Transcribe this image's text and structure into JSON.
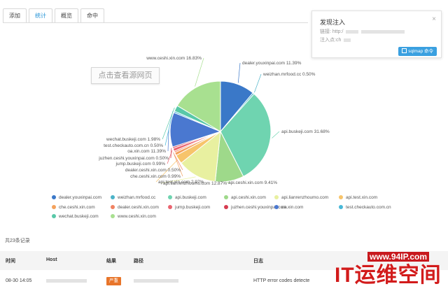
{
  "tabs": [
    {
      "label": "添加",
      "active": false
    },
    {
      "label": "统计",
      "active": true
    },
    {
      "label": "概览",
      "active": false
    },
    {
      "label": "命中",
      "active": false
    }
  ],
  "notify": {
    "title": "发现注入",
    "close": "×",
    "line1_prefix": "链接: http:/",
    "line2_prefix": "注入点:ch",
    "button": "sqlmap 命令"
  },
  "source_tip": "点击查看源网页",
  "chart_data": {
    "type": "pie",
    "slices": [
      {
        "name": "dealer.youxinpai.com",
        "label": "dealer.youxinpai.com 11.39%",
        "value": 11.39,
        "color": "#3a78c8"
      },
      {
        "name": "weizhan.mrfood.cc",
        "label": "weizhan.mrfood.cc 0.50%",
        "value": 0.5,
        "color": "#4bb3c8"
      },
      {
        "name": "api.buskeji.com",
        "label": "api.buskeji.com 31.68%",
        "value": 31.68,
        "color": "#6fd4b0"
      },
      {
        "name": "api.ceshi.xin.com",
        "label": "api.ceshi.xin.com 9.41%",
        "value": 9.41,
        "color": "#9ed98a"
      },
      {
        "name": "api.lianrenzhoumo.com",
        "label": "api.lianrenzhoumo.com 12.87%",
        "value": 12.87,
        "color": "#e8f0a0"
      },
      {
        "name": "api.test.xin.com",
        "label": "api.test.xin.com 2.97%",
        "value": 2.97,
        "color": "#f7c46b"
      },
      {
        "name": "che.ceshi.xin.com",
        "label": "che.ceshi.xin.com 0.99%",
        "value": 0.99,
        "color": "#f4a25c"
      },
      {
        "name": "dealer.ceshi.xin.com",
        "label": "dealer.ceshi.xin.com 0.50%",
        "value": 0.5,
        "color": "#f08262"
      },
      {
        "name": "jump.buskeji.com",
        "label": "jump.buskeji.com 0.99%",
        "value": 0.99,
        "color": "#ea6470"
      },
      {
        "name": "juzhen.ceshi.youxinpai.com",
        "label": "juzhen.ceshi.youxinpai.com 0.50%",
        "value": 0.5,
        "color": "#d63c50"
      },
      {
        "name": "oa.xin.com",
        "label": "oa.xin.com 11.39%",
        "value": 11.39,
        "color": "#4a78d0"
      },
      {
        "name": "test.checkauto.com.cn",
        "label": "test.checkauto.com.cn 0.50%",
        "value": 0.5,
        "color": "#48b8d8"
      },
      {
        "name": "wechat.buskeji.com",
        "label": "wechat.buskeji.com 1.98%",
        "value": 1.98,
        "color": "#58c8a8"
      },
      {
        "name": "www.ceshi.xin.com",
        "label": "www.ceshi.xin.com 16.83%",
        "value": 16.83,
        "color": "#a8e090"
      }
    ]
  },
  "legend": [
    "dealer.youxinpai.com",
    "weizhan.mrfood.cc",
    "api.buskeji.com",
    "api.ceshi.xin.com",
    "api.lianrenzhoumo.com",
    "api.test.xin.com",
    "che.ceshi.xin.com",
    "dealer.ceshi.xin.com",
    "jump.buskeji.com",
    "juzhen.ceshi.youxinpai.com",
    "oa.xin.com",
    "test.checkauto.com.cn",
    "wechat.buskeji.com",
    "www.ceshi.xin.com"
  ],
  "table": {
    "count_label": "共23条记录",
    "headers": {
      "time": "时间",
      "host": "Host",
      "result": "结果",
      "path": "路径",
      "log": "日志"
    },
    "row": {
      "time": "08-30 14:05",
      "severity": "严重",
      "log": "HTTP error codes detecte"
    }
  },
  "watermark": {
    "site": "www.94IP.com",
    "brand": "IT运维空间"
  }
}
